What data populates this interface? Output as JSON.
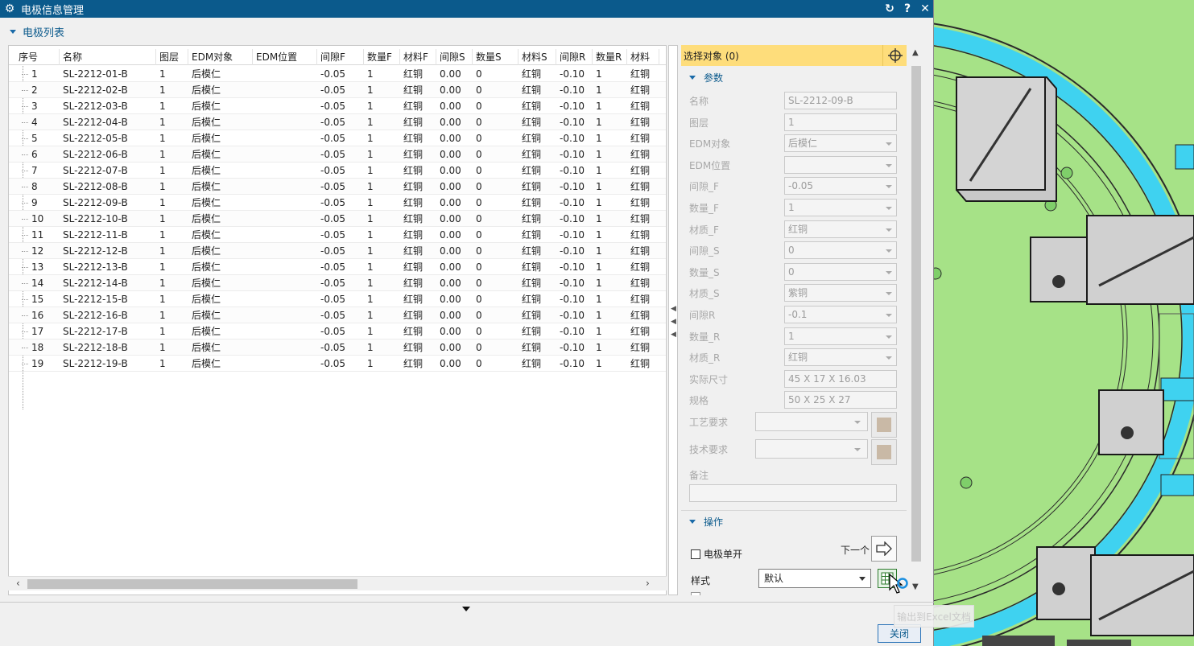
{
  "window": {
    "title": "电极信息管理",
    "icons": [
      "gear-icon",
      "reset-icon",
      "help-icon",
      "close-icon"
    ]
  },
  "list_section": {
    "title": "电极列表",
    "columns": [
      "序号",
      "名称",
      "图层",
      "EDM对象",
      "EDM位置",
      "间隙F",
      "数量F",
      "材料F",
      "间隙S",
      "数量S",
      "材料S",
      "间隙R",
      "数量R",
      "材料"
    ],
    "rows": [
      [
        "1",
        "SL-2212-01-B",
        "1",
        "后模仁",
        "",
        "-0.05",
        "1",
        "红铜",
        "0.00",
        "0",
        "红铜",
        "-0.10",
        "1",
        "红铜"
      ],
      [
        "2",
        "SL-2212-02-B",
        "1",
        "后模仁",
        "",
        "-0.05",
        "1",
        "红铜",
        "0.00",
        "0",
        "红铜",
        "-0.10",
        "1",
        "红铜"
      ],
      [
        "3",
        "SL-2212-03-B",
        "1",
        "后模仁",
        "",
        "-0.05",
        "1",
        "红铜",
        "0.00",
        "0",
        "红铜",
        "-0.10",
        "1",
        "红铜"
      ],
      [
        "4",
        "SL-2212-04-B",
        "1",
        "后模仁",
        "",
        "-0.05",
        "1",
        "红铜",
        "0.00",
        "0",
        "红铜",
        "-0.10",
        "1",
        "红铜"
      ],
      [
        "5",
        "SL-2212-05-B",
        "1",
        "后模仁",
        "",
        "-0.05",
        "1",
        "红铜",
        "0.00",
        "0",
        "红铜",
        "-0.10",
        "1",
        "红铜"
      ],
      [
        "6",
        "SL-2212-06-B",
        "1",
        "后模仁",
        "",
        "-0.05",
        "1",
        "红铜",
        "0.00",
        "0",
        "红铜",
        "-0.10",
        "1",
        "红铜"
      ],
      [
        "7",
        "SL-2212-07-B",
        "1",
        "后模仁",
        "",
        "-0.05",
        "1",
        "红铜",
        "0.00",
        "0",
        "红铜",
        "-0.10",
        "1",
        "红铜"
      ],
      [
        "8",
        "SL-2212-08-B",
        "1",
        "后模仁",
        "",
        "-0.05",
        "1",
        "红铜",
        "0.00",
        "0",
        "红铜",
        "-0.10",
        "1",
        "红铜"
      ],
      [
        "9",
        "SL-2212-09-B",
        "1",
        "后模仁",
        "",
        "-0.05",
        "1",
        "红铜",
        "0.00",
        "0",
        "红铜",
        "-0.10",
        "1",
        "红铜"
      ],
      [
        "10",
        "SL-2212-10-B",
        "1",
        "后模仁",
        "",
        "-0.05",
        "1",
        "红铜",
        "0.00",
        "0",
        "红铜",
        "-0.10",
        "1",
        "红铜"
      ],
      [
        "11",
        "SL-2212-11-B",
        "1",
        "后模仁",
        "",
        "-0.05",
        "1",
        "红铜",
        "0.00",
        "0",
        "红铜",
        "-0.10",
        "1",
        "红铜"
      ],
      [
        "12",
        "SL-2212-12-B",
        "1",
        "后模仁",
        "",
        "-0.05",
        "1",
        "红铜",
        "0.00",
        "0",
        "红铜",
        "-0.10",
        "1",
        "红铜"
      ],
      [
        "13",
        "SL-2212-13-B",
        "1",
        "后模仁",
        "",
        "-0.05",
        "1",
        "红铜",
        "0.00",
        "0",
        "红铜",
        "-0.10",
        "1",
        "红铜"
      ],
      [
        "14",
        "SL-2212-14-B",
        "1",
        "后模仁",
        "",
        "-0.05",
        "1",
        "红铜",
        "0.00",
        "0",
        "红铜",
        "-0.10",
        "1",
        "红铜"
      ],
      [
        "15",
        "SL-2212-15-B",
        "1",
        "后模仁",
        "",
        "-0.05",
        "1",
        "红铜",
        "0.00",
        "0",
        "红铜",
        "-0.10",
        "1",
        "红铜"
      ],
      [
        "16",
        "SL-2212-16-B",
        "1",
        "后模仁",
        "",
        "-0.05",
        "1",
        "红铜",
        "0.00",
        "0",
        "红铜",
        "-0.10",
        "1",
        "红铜"
      ],
      [
        "17",
        "SL-2212-17-B",
        "1",
        "后模仁",
        "",
        "-0.05",
        "1",
        "红铜",
        "0.00",
        "0",
        "红铜",
        "-0.10",
        "1",
        "红铜"
      ],
      [
        "18",
        "SL-2212-18-B",
        "1",
        "后模仁",
        "",
        "-0.05",
        "1",
        "红铜",
        "0.00",
        "0",
        "红铜",
        "-0.10",
        "1",
        "红铜"
      ],
      [
        "19",
        "SL-2212-19-B",
        "1",
        "后模仁",
        "",
        "-0.05",
        "1",
        "红铜",
        "0.00",
        "0",
        "红铜",
        "-0.10",
        "1",
        "红铜"
      ]
    ]
  },
  "selection": {
    "label": "选择对象 (0)",
    "icon": "crosshair-icon"
  },
  "params": {
    "title": "参数",
    "fields": [
      {
        "key": "name",
        "label": "名称",
        "value": "SL-2212-09-B",
        "dropdown": false
      },
      {
        "key": "layer",
        "label": "图层",
        "value": "1",
        "dropdown": false
      },
      {
        "key": "edm_obj",
        "label": "EDM对象",
        "value": "后模仁",
        "dropdown": true
      },
      {
        "key": "edm_pos",
        "label": "EDM位置",
        "value": "",
        "dropdown": true
      },
      {
        "key": "gap_f",
        "label": "间隙_F",
        "value": "-0.05",
        "dropdown": true
      },
      {
        "key": "num_f",
        "label": "数量_F",
        "value": "1",
        "dropdown": true
      },
      {
        "key": "mat_f",
        "label": "材质_F",
        "value": "红铜",
        "dropdown": true
      },
      {
        "key": "gap_s",
        "label": "间隙_S",
        "value": "0",
        "dropdown": true
      },
      {
        "key": "num_s",
        "label": "数量_S",
        "value": "0",
        "dropdown": true
      },
      {
        "key": "mat_s",
        "label": "材质_S",
        "value": "紫铜",
        "dropdown": true
      },
      {
        "key": "gap_r",
        "label": "间隙R",
        "value": "-0.1",
        "dropdown": true
      },
      {
        "key": "num_r",
        "label": "数量_R",
        "value": "1",
        "dropdown": true
      },
      {
        "key": "mat_r",
        "label": "材质_R",
        "value": "红铜",
        "dropdown": true
      },
      {
        "key": "actual_size",
        "label": "实际尺寸",
        "value": "45 X 17 X 16.03",
        "dropdown": false
      },
      {
        "key": "spec",
        "label": "规格",
        "value": "50 X 25 X 27",
        "dropdown": false
      }
    ],
    "process_label": "工艺要求",
    "tech_label": "技术要求",
    "remark_label": "备注"
  },
  "ops": {
    "title": "操作",
    "next_label": "下一个",
    "single_label": "电极单开",
    "style_label": "样式",
    "style_value": "默认",
    "tooltip": "输出到Excel文档"
  },
  "footer": {
    "close_label": "关闭"
  },
  "colors": {
    "titlebar": "#0b5a8c",
    "selection_bar": "#fedd7b",
    "viewport_bg": "#a6e287"
  }
}
